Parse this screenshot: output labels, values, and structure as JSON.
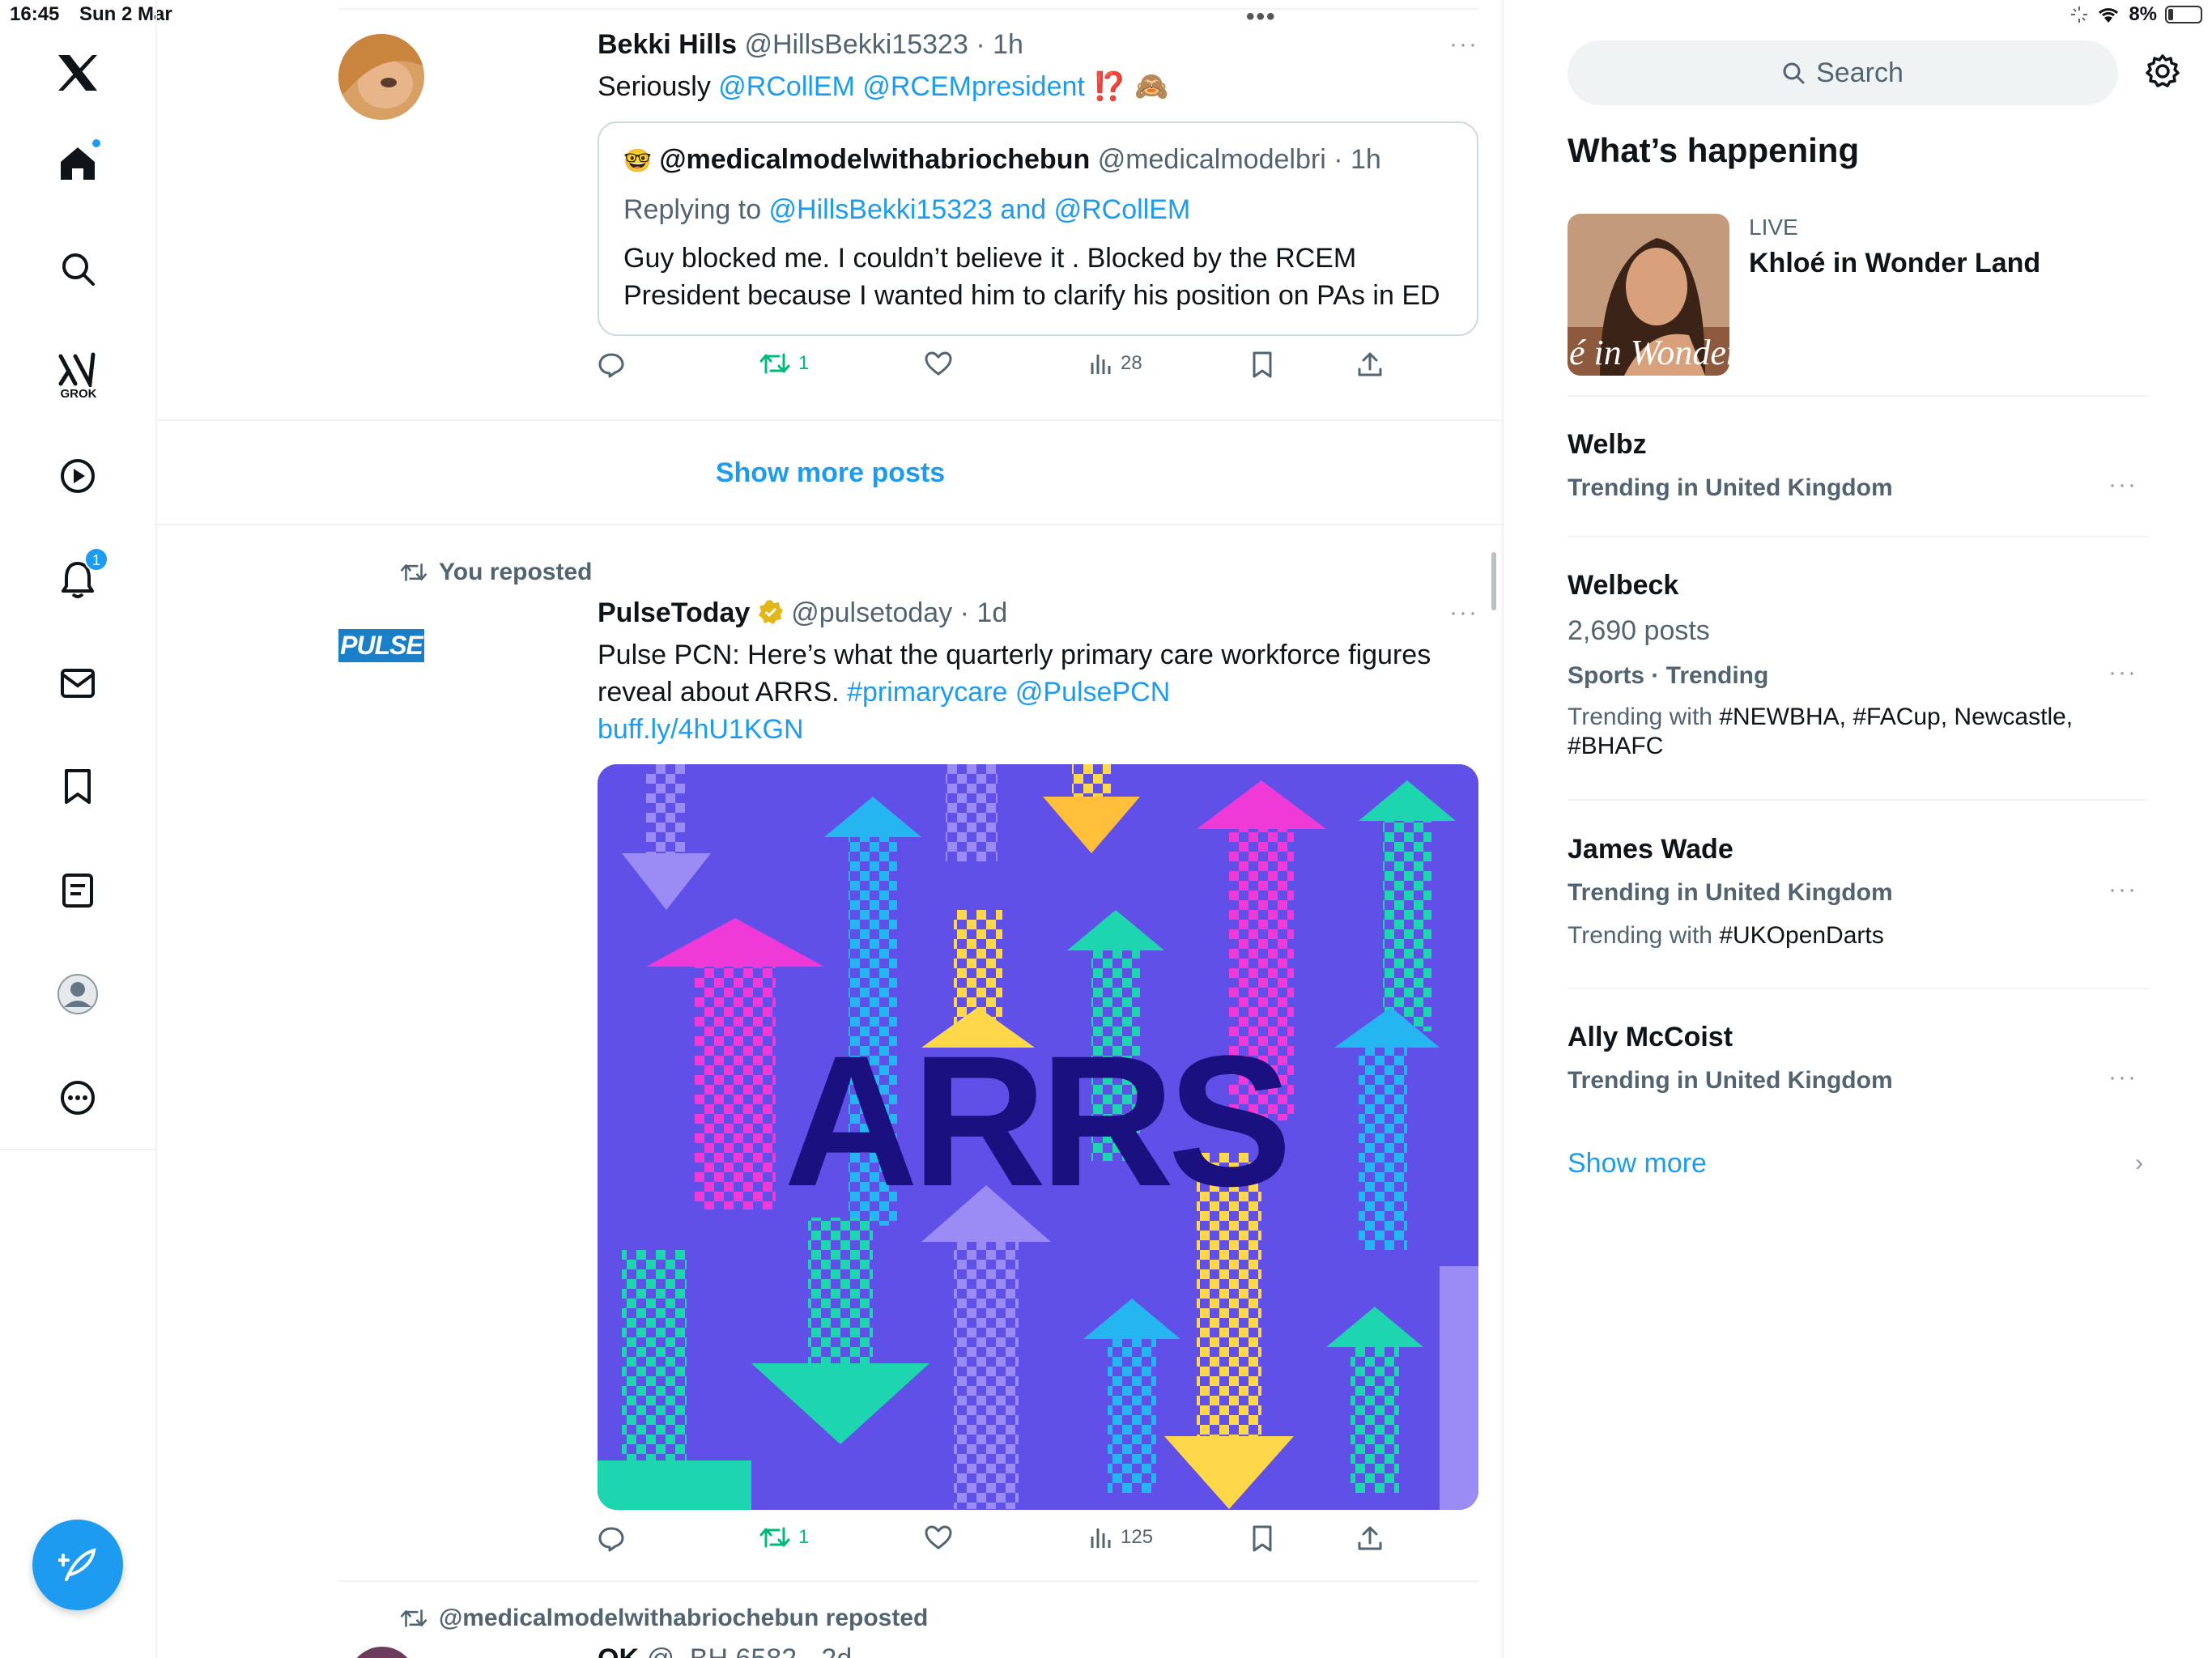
{
  "status": {
    "time": "16:45",
    "date": "Sun 2 Mar",
    "battery": "8%"
  },
  "nav": {
    "grok_label": "GROK",
    "notif_count": "1",
    "icons": [
      "x-logo-icon",
      "home-icon",
      "search-icon",
      "grok-icon",
      "video-icon",
      "bell-icon",
      "mail-icon",
      "bookmark-icon",
      "lists-icon",
      "profile-icon",
      "more-icon",
      "compose-icon"
    ]
  },
  "tweet1": {
    "name": "Bekki Hills",
    "handle": "@HillsBekki15323",
    "time": "· 1h",
    "text_plain": "Seriously ",
    "text_links": "@RCollEM @RCEMpresident",
    "text_emoji": "⁉️ 🙈",
    "quote": {
      "emoji": "🤓",
      "name": "@medicalmodelwithabriochebun",
      "handle": "@medicalmodelbri",
      "time": "· 1h",
      "replying_prefix": "Replying to ",
      "replying_to": "@HillsBekki15323 and @RCollEM",
      "text": "Guy blocked me. I couldn’t believe it . Blocked by the RCEM President because I wanted him to clarify his position on PAs in ED"
    },
    "retweets": "1",
    "views": "28"
  },
  "show_more_posts": "Show more posts",
  "tweet2": {
    "reposted_label": "You reposted",
    "avatar_text": "PULSE",
    "name": "PulseToday",
    "handle": "@pulsetoday",
    "time": "· 1d",
    "text_line1": "Pulse PCN: Here’s what the quarterly primary care workforce figures",
    "text_line2_plain": "reveal about ARRS. ",
    "text_line2_links": "#primarycare @PulsePCN",
    "text_line3_link": "buff.ly/4hU1KGN",
    "media_text": "ARRS",
    "retweets": "1",
    "views": "125"
  },
  "tweet3": {
    "reposted_label": "@medicalmodelwithabriochebun reposted",
    "partial_name": "OK",
    "partial_handle": "@_BH 6582 · 2d"
  },
  "right": {
    "search_placeholder": "Search",
    "whats_happening": "What’s happening",
    "live": {
      "label": "LIVE",
      "title": "Khloé in Wonder Land",
      "thumb_text": "é in Wonder L"
    },
    "trends": [
      {
        "name": "Welbz",
        "meta": "Trending in United Kingdom"
      },
      {
        "name": "Welbeck",
        "count": "2,690 posts",
        "meta": "Sports · Trending",
        "with_prefix": "Trending with ",
        "with_tags": "#NEWBHA, #FACup, Newcastle, #BHAFC"
      },
      {
        "name": "James Wade",
        "meta": "Trending in United Kingdom",
        "with_prefix": "Trending with ",
        "with_tags": "#UKOpenDarts"
      },
      {
        "name": "Ally McCoist",
        "meta": "Trending in United Kingdom"
      }
    ],
    "show_more": "Show more"
  },
  "colors": {
    "accent": "#1d9bf0",
    "retweet_green": "#00ba7c",
    "muted": "#536471",
    "media_bg": "#6050e8"
  }
}
